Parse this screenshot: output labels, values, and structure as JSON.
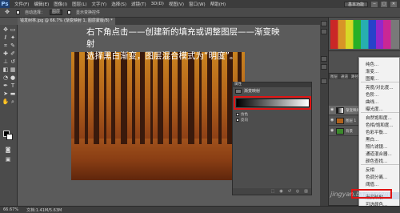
{
  "menubar": {
    "logo": "Ps",
    "items": [
      "文件(F)",
      "编辑(E)",
      "图像(I)",
      "图层(L)",
      "文字(Y)",
      "选择(S)",
      "滤镜(T)",
      "3D(D)",
      "视图(V)",
      "窗口(W)",
      "帮助(H)"
    ],
    "essentials": "基本功能",
    "window_controls": [
      "─",
      "□",
      "✕"
    ]
  },
  "options": {
    "auto_select": "自动选择：",
    "target": "图层",
    "show_transform": "显示变换控件"
  },
  "document": {
    "tab_label": "钱发树林.jpg @ 66.7% (渐变映射 1, 图层蒙版/8) *"
  },
  "annotation": {
    "line1": "右下角点击——创建新的填充或调整图层——渐变映射",
    "line2": "选择黑白渐变，图层混合模式为“明度”。"
  },
  "properties": {
    "header": "属性",
    "title": "渐变映射",
    "option1": "仿色",
    "option2": "反向"
  },
  "layers": {
    "tabs": [
      "图层",
      "通道",
      "路径"
    ],
    "rows": [
      "渐变映射 1",
      "图层 1",
      "背景"
    ]
  },
  "menu": {
    "items": [
      "纯色...",
      "渐变...",
      "图案...",
      "亮度/对比度...",
      "色阶...",
      "曲线...",
      "曝光度...",
      "自然饱和度...",
      "色相/饱和度...",
      "色彩平衡...",
      "黑白...",
      "照片滤镜...",
      "通道混合器...",
      "颜色查找...",
      "反相",
      "色调分离...",
      "阈值...",
      "渐变映射...",
      "可选颜色..."
    ]
  },
  "status": {
    "zoom": "66.67%",
    "doc_info": "文档:1.41M/5.63M"
  },
  "watermark": "jingyan.baidu.com",
  "colors": {
    "accent_red": "#e01414",
    "ps_blue": "#1f3f6f"
  }
}
